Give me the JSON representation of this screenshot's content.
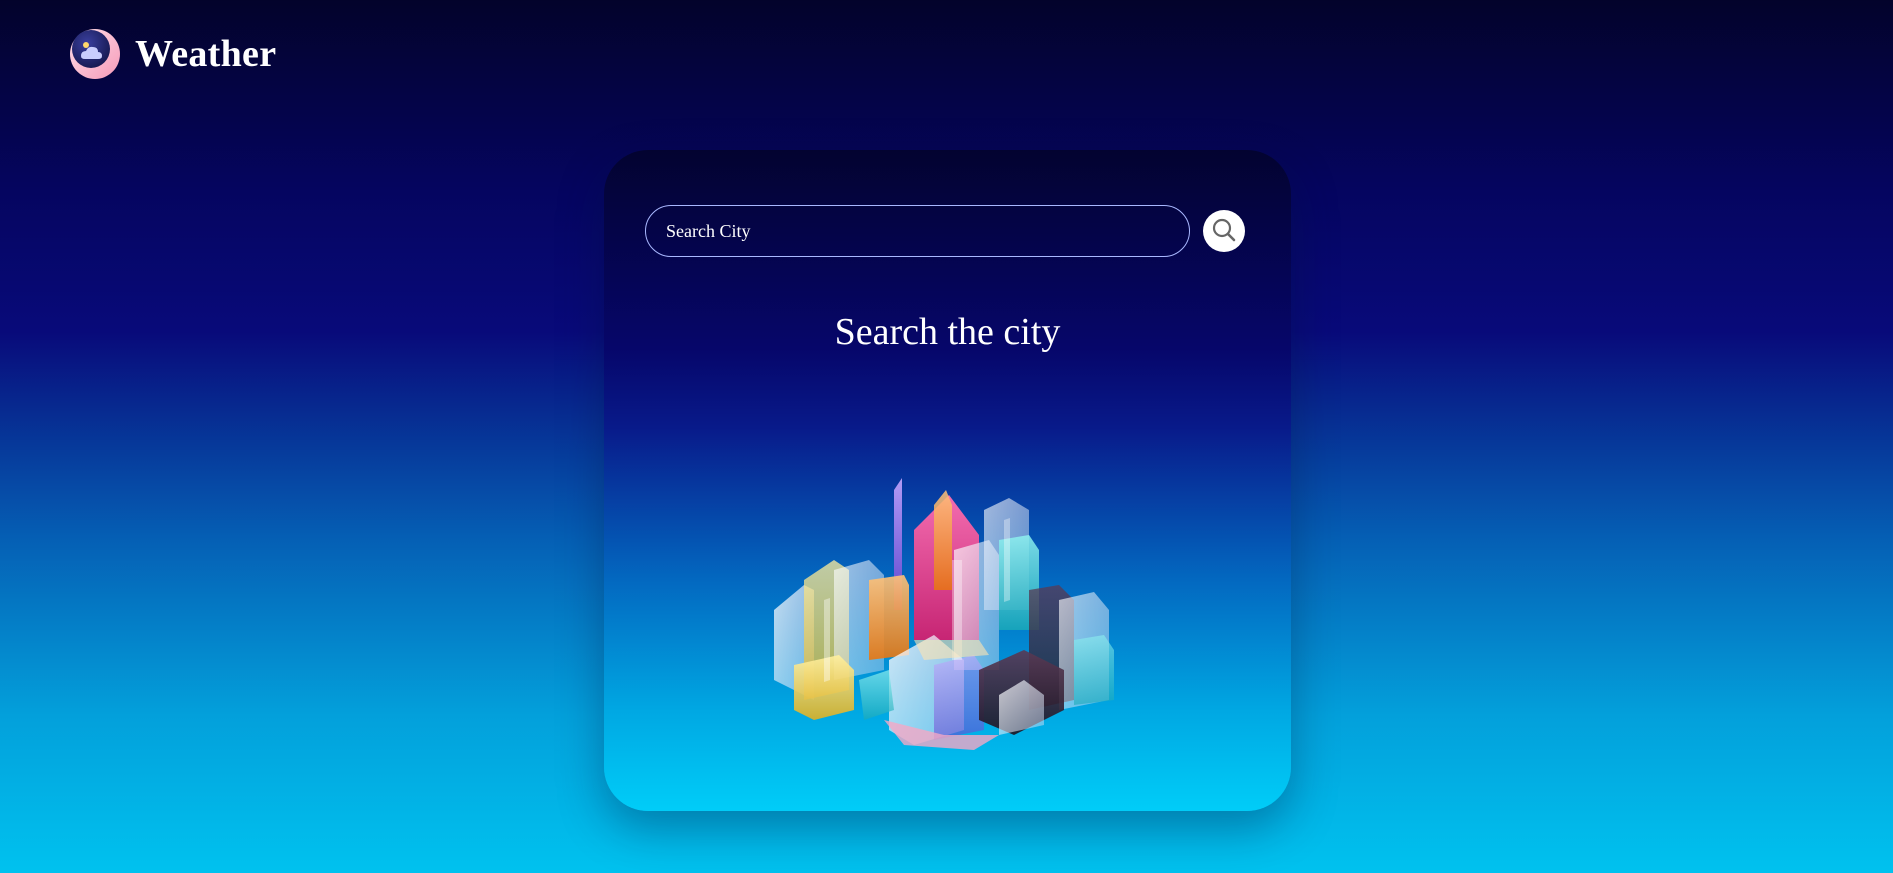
{
  "header": {
    "brand": "Weather",
    "logo_icon": "moon-cloud-icon"
  },
  "search": {
    "placeholder": "Search City",
    "value": "",
    "button_icon": "search-icon"
  },
  "main": {
    "heading": "Search the city",
    "illustration": "glass-city-illustration"
  },
  "colors": {
    "background_top": "#03032b",
    "background_bottom": "#00c2ef",
    "card_top": "#030330",
    "card_bottom": "#00cdf8",
    "text": "#ffffff",
    "input_border": "#a9b8ff"
  }
}
